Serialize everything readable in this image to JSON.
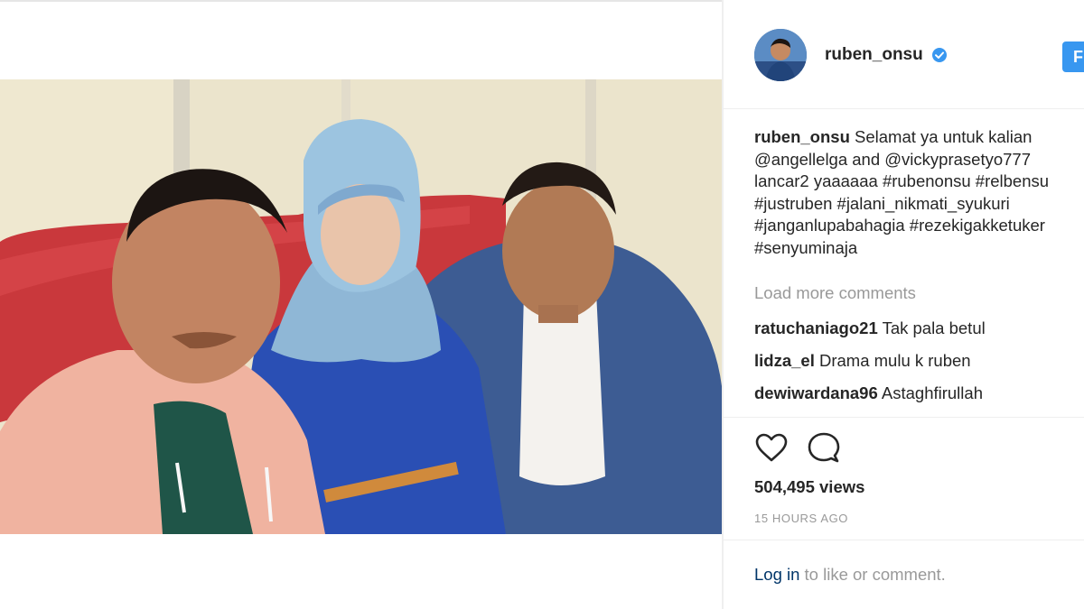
{
  "post": {
    "author": "ruben_onsu",
    "verified": true,
    "follow_label": "F",
    "caption_lines": [
      "Selamat ya untuk kalian",
      "@angellelga and @vickyprasetyo777",
      "lancar2 yaaaaaa #rubenonsu #relbensu",
      "#justruben #jalani_nikmati_syukuri",
      "#janganlupabahagia #rezekigakketuker",
      "#senyuminaja"
    ],
    "load_more": "Load more comments",
    "comments": [
      {
        "user": "ratuchaniago21",
        "text": "Tak pala betul"
      },
      {
        "user": "lidza_el",
        "text": "Drama mulu k ruben"
      },
      {
        "user": "dewiwardana96",
        "text": "Astaghfirullah"
      }
    ],
    "views": "504,495 views",
    "timestamp": "15 HOURS AGO",
    "login": {
      "link": "Log in",
      "rest": " to like or comment."
    }
  },
  "icons": {
    "verified": "verified-badge-icon",
    "like": "heart-icon",
    "comment": "comment-bubble-icon"
  },
  "colors": {
    "accent": "#3897f0",
    "link": "#003569",
    "muted": "#999999",
    "text": "#262626"
  }
}
